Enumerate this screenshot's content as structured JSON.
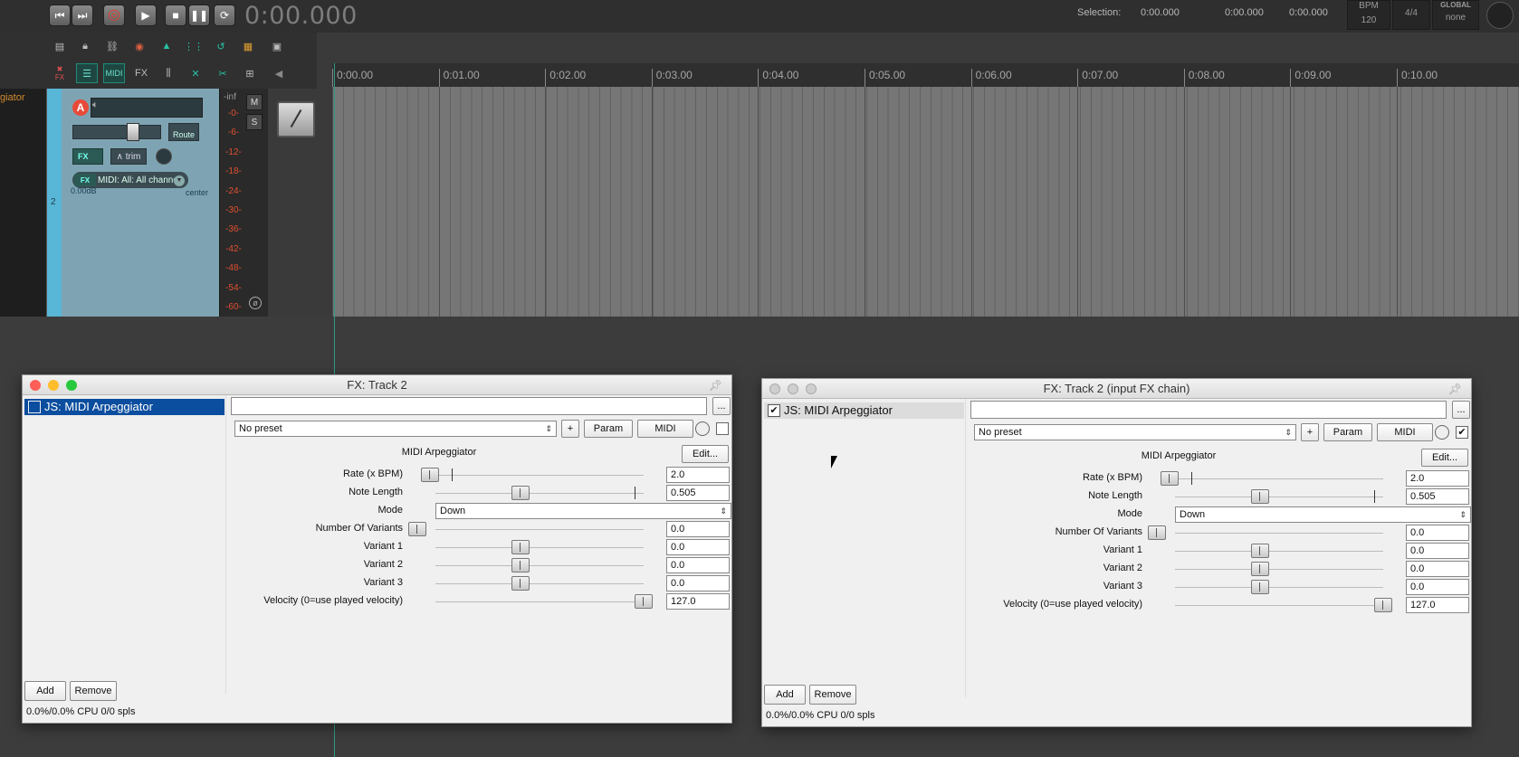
{
  "transport": {
    "timecode": "0:00.000",
    "selection_label": "Selection:",
    "sel_start": "0:00.000",
    "sel_end": "0:00.000",
    "sel_len": "0:00.000",
    "bpm_label": "BPM",
    "bpm": "120",
    "timesig": "4/4",
    "global_label": "GLOBAL",
    "global_value": "none"
  },
  "toolbar": {
    "fx": "FX",
    "midi": "MIDI",
    "fx2": "FX"
  },
  "ruler": [
    "0:00.00",
    "0:01.00",
    "0:02.00",
    "0:03.00",
    "0:04.00",
    "0:05.00",
    "0:06.00",
    "0:07.00",
    "0:08.00",
    "0:09.00",
    "0:10.00"
  ],
  "track": {
    "number": "2",
    "left_name": "giator",
    "arm": "A",
    "route": "Route",
    "fx": "FX",
    "trim": "trim",
    "midi_input": "MIDI: All: All channe",
    "midi_fx": "FX",
    "volume": "0.00dB",
    "pan": "center",
    "meter_inf": "-inf",
    "meter_scale": [
      "-0-",
      "-6-",
      "-12-",
      "-18-",
      "-24-",
      "-30-",
      "-36-",
      "-42-",
      "-48-",
      "-54-",
      "-60-"
    ],
    "mute": "M",
    "solo": "S",
    "phase": "ø"
  },
  "windows": [
    {
      "title": "FX: Track 2",
      "fx_name": "JS: MIDI Arpeggiator",
      "preset": "No preset",
      "plus": "+",
      "param": "Param",
      "midi": "MIDI",
      "more": "...",
      "plugin_title": "MIDI Arpeggiator",
      "edit": "Edit...",
      "params": [
        {
          "label": "Rate (x BPM)",
          "value": "2.0"
        },
        {
          "label": "Note Length",
          "value": "0.505"
        },
        {
          "label": "Mode",
          "value": "Down"
        },
        {
          "label": "Number Of Variants",
          "value": "0.0"
        },
        {
          "label": "Variant 1",
          "value": "0.0"
        },
        {
          "label": "Variant 2",
          "value": "0.0"
        },
        {
          "label": "Variant 3",
          "value": "0.0"
        },
        {
          "label": "Velocity (0=use played velocity)",
          "value": "127.0"
        }
      ],
      "add": "Add",
      "remove": "Remove",
      "cpu": "0.0%/0.0% CPU 0/0 spls"
    },
    {
      "title": "FX: Track 2 (input FX chain)",
      "fx_name": "JS: MIDI Arpeggiator",
      "preset": "No preset",
      "plus": "+",
      "param": "Param",
      "midi": "MIDI",
      "more": "...",
      "plugin_title": "MIDI Arpeggiator",
      "edit": "Edit...",
      "params": [
        {
          "label": "Rate (x BPM)",
          "value": "2.0"
        },
        {
          "label": "Note Length",
          "value": "0.505"
        },
        {
          "label": "Mode",
          "value": "Down"
        },
        {
          "label": "Number Of Variants",
          "value": "0.0"
        },
        {
          "label": "Variant 1",
          "value": "0.0"
        },
        {
          "label": "Variant 2",
          "value": "0.0"
        },
        {
          "label": "Variant 3",
          "value": "0.0"
        },
        {
          "label": "Velocity (0=use played velocity)",
          "value": "127.0"
        }
      ],
      "add": "Add",
      "remove": "Remove",
      "cpu": "0.0%/0.0% CPU 0/0 spls"
    }
  ],
  "icons": [
    "skip-back-icon",
    "skip-forward-icon",
    "record-icon",
    "play-icon",
    "stop-icon",
    "pause-icon",
    "repeat-icon",
    "pin-icon",
    "checkbox-checked-icon",
    "mouse-pointer-icon"
  ]
}
